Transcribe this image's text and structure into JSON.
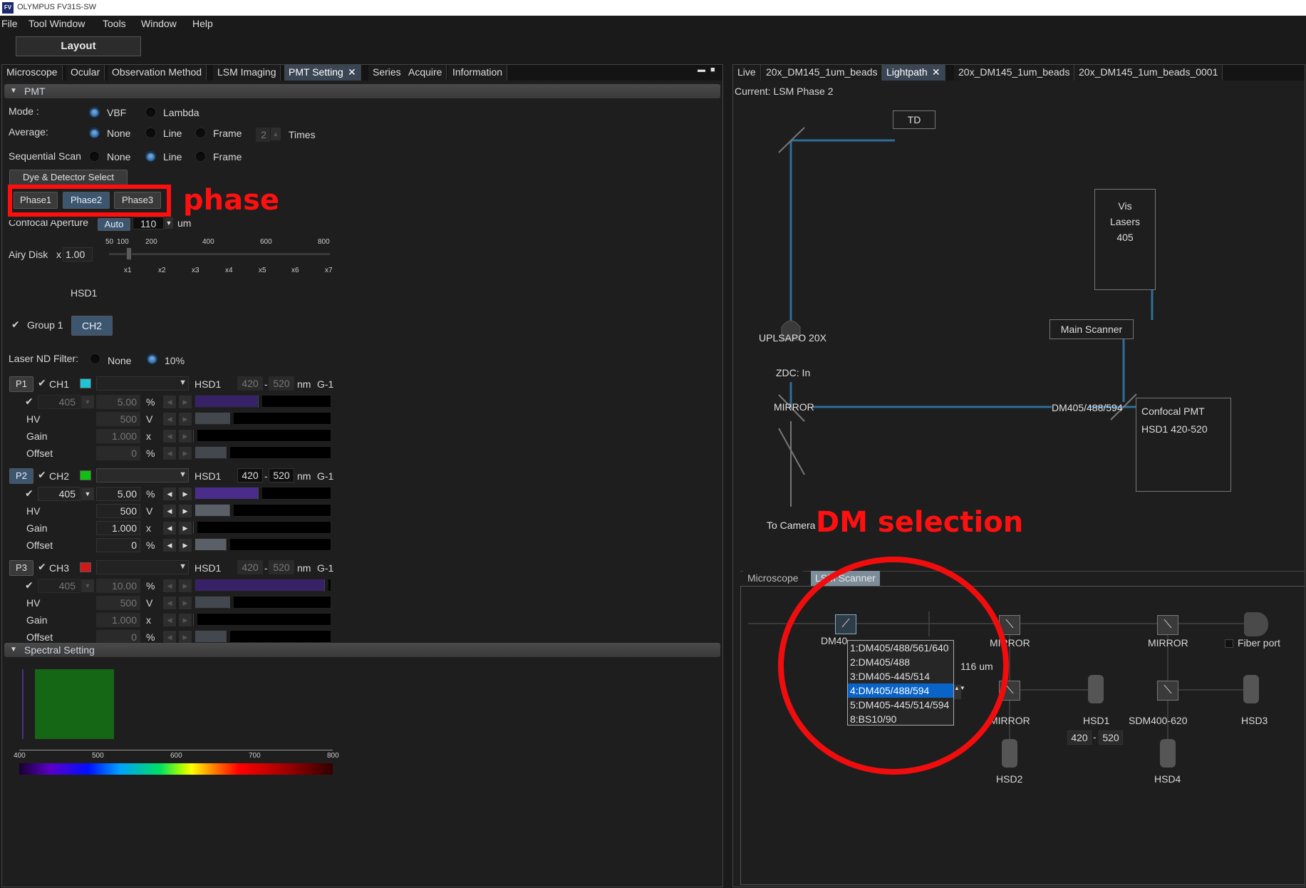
{
  "app": {
    "title": "OLYMPUS FV31S-SW",
    "logo": "FV"
  },
  "menu": [
    "File",
    "Tool Window",
    "Tools",
    "Window",
    "Help"
  ],
  "layout_button": "Layout",
  "left_tabs": [
    "Microscope",
    "Ocular",
    "Observation Method",
    "LSM Imaging",
    "PMT Setting",
    "Series",
    "Acquire",
    "Information"
  ],
  "left_active_tab": "PMT Setting",
  "pmt": {
    "section_title": "PMT",
    "mode_label": "Mode :",
    "mode_options": [
      "VBF",
      "Lambda"
    ],
    "average_label": "Average:",
    "average_options": [
      "None",
      "Line",
      "Frame"
    ],
    "average_times_value": "2",
    "average_times_unit": "Times",
    "sequential_label": "Sequential Scan",
    "sequential_options": [
      "None",
      "Line",
      "Frame"
    ],
    "dye_button": "Dye & Detector Select",
    "phases": [
      "Phase1",
      "Phase2",
      "Phase3"
    ],
    "phase_annotation": "phase",
    "confocal_label": "Confocal Aperture",
    "confocal_auto": "Auto",
    "confocal_value": "110",
    "confocal_unit": "um",
    "airy_label": "Airy Disk",
    "airy_x": "x",
    "airy_value": "1.00",
    "airy_ticks_top": [
      "50",
      "100",
      "200",
      "400",
      "600",
      "800"
    ],
    "airy_ticks_bottom": [
      "x1",
      "x2",
      "x3",
      "x4",
      "x5",
      "x6",
      "x7"
    ],
    "hsd_label": "HSD1",
    "group_label": "Group 1",
    "group_ch": "CH2",
    "laser_nd_label": "Laser ND Filter:",
    "laser_nd_options": [
      "None",
      "10%"
    ],
    "row_labels": {
      "hv": "HV",
      "gain": "Gain",
      "offset": "Offset"
    },
    "units": {
      "laser": "%",
      "hv": "V",
      "gain": "x",
      "offset": "%",
      "nm": "nm"
    },
    "channels": [
      {
        "p": "P1",
        "ch": "CH1",
        "color": "#1fc3d6",
        "detector": "HSD1",
        "nm_from": "420",
        "nm_to": "520",
        "gain_label": "G-1",
        "wavelength": "405",
        "laser": "5.00",
        "hv": "500",
        "gain": "1.000",
        "offset": "0",
        "laser_level": 0.48,
        "hv_level": 0.27,
        "gain_level": 0.0,
        "offset_level": 0.24,
        "enabled": false
      },
      {
        "p": "P2",
        "ch": "CH2",
        "color": "#11c011",
        "detector": "HSD1",
        "nm_from": "420",
        "nm_to": "520",
        "gain_label": "G-1",
        "wavelength": "405",
        "laser": "5.00",
        "hv": "500",
        "gain": "1.000",
        "offset": "0",
        "laser_level": 0.48,
        "hv_level": 0.27,
        "gain_level": 0.0,
        "offset_level": 0.24,
        "enabled": true
      },
      {
        "p": "P3",
        "ch": "CH3",
        "color": "#d01a1a",
        "detector": "HSD1",
        "nm_from": "420",
        "nm_to": "520",
        "gain_label": "G-1",
        "wavelength": "405",
        "laser": "10.00",
        "hv": "500",
        "gain": "1.000",
        "offset": "0",
        "laser_level": 0.97,
        "hv_level": 0.27,
        "gain_level": 0.0,
        "offset_level": 0.24,
        "enabled": false
      }
    ]
  },
  "spectral": {
    "section_title": "Spectral Setting",
    "ticks": [
      "400",
      "500",
      "600",
      "700",
      "800"
    ],
    "band_color": "#156615"
  },
  "right_tabs": [
    "Live",
    "20x_DM145_1um_beads",
    "Lightpath",
    "20x_DM145_1um_beads",
    "20x_DM145_1um_beads_0001"
  ],
  "right_active_tab": "Lightpath",
  "lightpath": {
    "current": "Current: LSM Phase 2",
    "td": "TD",
    "vis_lasers": [
      "Vis",
      "Lasers",
      "405"
    ],
    "main_scanner": "Main Scanner",
    "objective": "UPLSAPO 20X",
    "zdc": "ZDC: In",
    "mirror": "MIRROR",
    "dm": "DM405/488/594",
    "confocal_pmt": [
      "Confocal PMT",
      "HSD1 420-520"
    ],
    "to_camera": "To Camera",
    "dm_annotation": "DM selection"
  },
  "scanner_tabs": [
    "Microscope",
    "LSM Scanner"
  ],
  "scanner_active_tab": "LSM Scanner",
  "scanner": {
    "dm_prefix": "DM40",
    "pinhole": "116 um",
    "mirror_label": "MIRROR",
    "fiber_port": "Fiber port",
    "sdm": "SDM400-620",
    "hsd": [
      "HSD1",
      "HSD2",
      "HSD3",
      "HSD4"
    ],
    "hsd1_from": "420",
    "hsd1_to": "520",
    "dm_options": [
      "1:DM405/488/561/640",
      "2:DM405/488",
      "3:DM405-445/514",
      "4:DM405/488/594",
      "5:DM405-445/514/594",
      "8:BS10/90"
    ],
    "dm_selected_index": 3
  }
}
